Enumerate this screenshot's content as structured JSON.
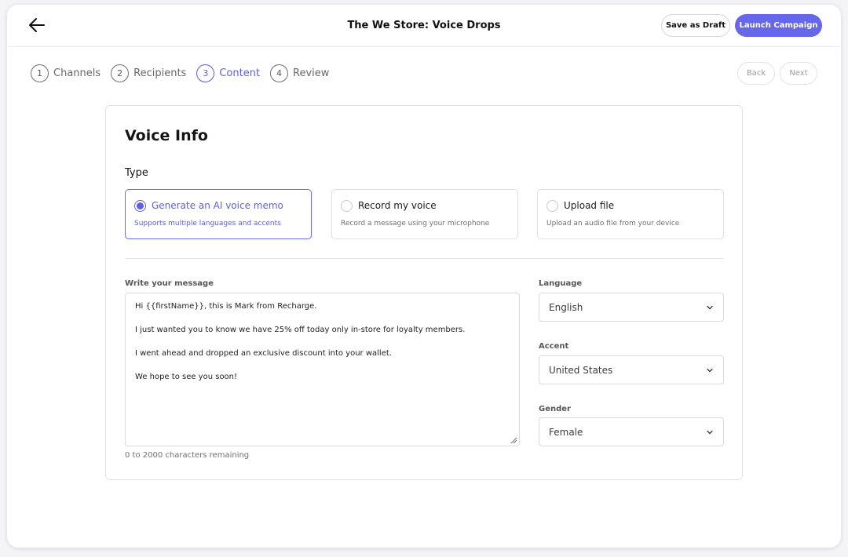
{
  "header": {
    "title": "The We Store: Voice Drops",
    "save_draft_label": "Save as Draft",
    "launch_label": "Launch Campaign"
  },
  "steps": [
    {
      "num": "1",
      "label": "Channels"
    },
    {
      "num": "2",
      "label": "Recipients"
    },
    {
      "num": "3",
      "label": "Content"
    },
    {
      "num": "4",
      "label": "Review"
    }
  ],
  "active_step": 3,
  "nav": {
    "back_label": "Back",
    "next_label": "Next"
  },
  "card": {
    "title": "Voice Info",
    "type_label": "Type",
    "type_options": [
      {
        "title": "Generate an AI voice memo",
        "subtitle": "Supports multiple languages and accents",
        "selected": true
      },
      {
        "title": "Record my voice",
        "subtitle": "Record a message using your microphone",
        "selected": false
      },
      {
        "title": "Upload file",
        "subtitle": "Upload an audio file from your device",
        "selected": false
      }
    ],
    "message": {
      "label": "Write your message",
      "lines": [
        "Hi {{firstName}}, this is Mark from Recharge.",
        "I just wanted you to know we have 25% off today only in-store for loyalty members.",
        "I went ahead and dropped an exclusive discount into your wallet.",
        "We hope to see you soon!"
      ],
      "char_count": "0 to 2000 characters remaining"
    },
    "language": {
      "label": "Language",
      "value": "English"
    },
    "accent": {
      "label": "Accent",
      "value": "United States"
    },
    "gender": {
      "label": "Gender",
      "value": "Female"
    }
  },
  "colors": {
    "accent": "#5e5fe6",
    "launch_button": "#6667ea"
  },
  "icons": {
    "back": "arrow-left-icon",
    "chevron": "chevron-down-icon",
    "resize": "resize-grip-icon"
  }
}
